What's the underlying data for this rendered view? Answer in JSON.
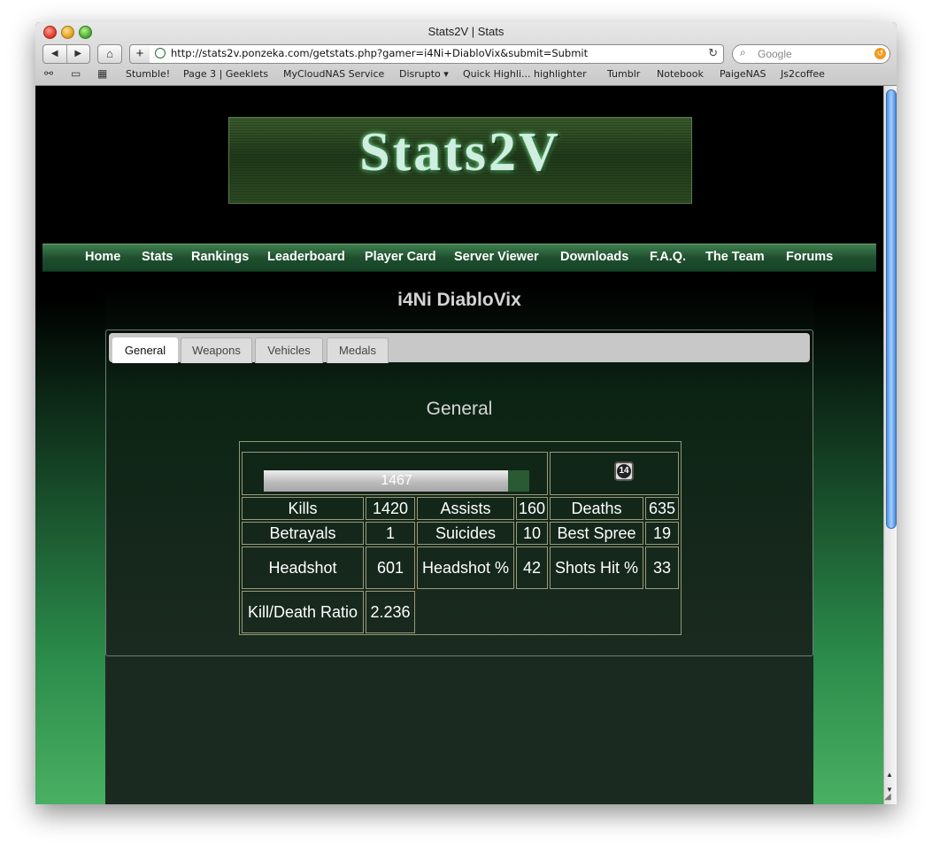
{
  "window": {
    "title": "Stats2V | Stats"
  },
  "toolbar": {
    "back": "◀",
    "forward": "▶",
    "home": "⌂",
    "add": "+",
    "url": "http://stats2v.ponzeka.com/getstats.php?gamer=i4Ni+DiabloVix&submit=Submit",
    "reload": "↻",
    "search_placeholder": "Google"
  },
  "bookmarks": [
    "Stumble!",
    "Page 3 | Geeklets",
    "MyCloudNAS Service",
    "Disrupto ▾",
    "Quick Highli... highlighter",
    "Tumblr",
    "Notebook",
    "PaigeNAS",
    "Js2coffee"
  ],
  "site": {
    "logo_text": "Stats2V",
    "nav": [
      "Home",
      "Stats",
      "Rankings",
      "Leaderboard",
      "Player Card",
      "Server Viewer",
      "Downloads",
      "F.A.Q.",
      "The Team",
      "Forums"
    ]
  },
  "player": {
    "name": "i4Ni DiabloVix",
    "tabs": [
      "General",
      "Weapons",
      "Vehicles",
      "Medals"
    ],
    "active_tab": "General",
    "section_title": "General",
    "xp_value": "1467",
    "xp_fill_fraction": 0.92,
    "rank": "14",
    "stats": {
      "kills_label": "Kills",
      "kills_value": "1420",
      "assists_label": "Assists",
      "assists_value": "160",
      "deaths_label": "Deaths",
      "deaths_value": "635",
      "betrayals_label": "Betrayals",
      "betrayals_value": "1",
      "suicides_label": "Suicides",
      "suicides_value": "10",
      "best_spree_label": "Best Spree",
      "best_spree_value": "19",
      "headshot_label": "Headshot",
      "headshot_value": "601",
      "headshot_pct_label": "Headshot %",
      "headshot_pct_value": "42",
      "shots_hit_label": "Shots Hit %",
      "shots_hit_value": "33",
      "kd_label": "Kill/Death Ratio",
      "kd_value": "2.236"
    }
  },
  "colors": {
    "nav_green": "#1f4f2f",
    "page_bottom_green": "#49b062",
    "xp_track": "#2a5a34"
  }
}
